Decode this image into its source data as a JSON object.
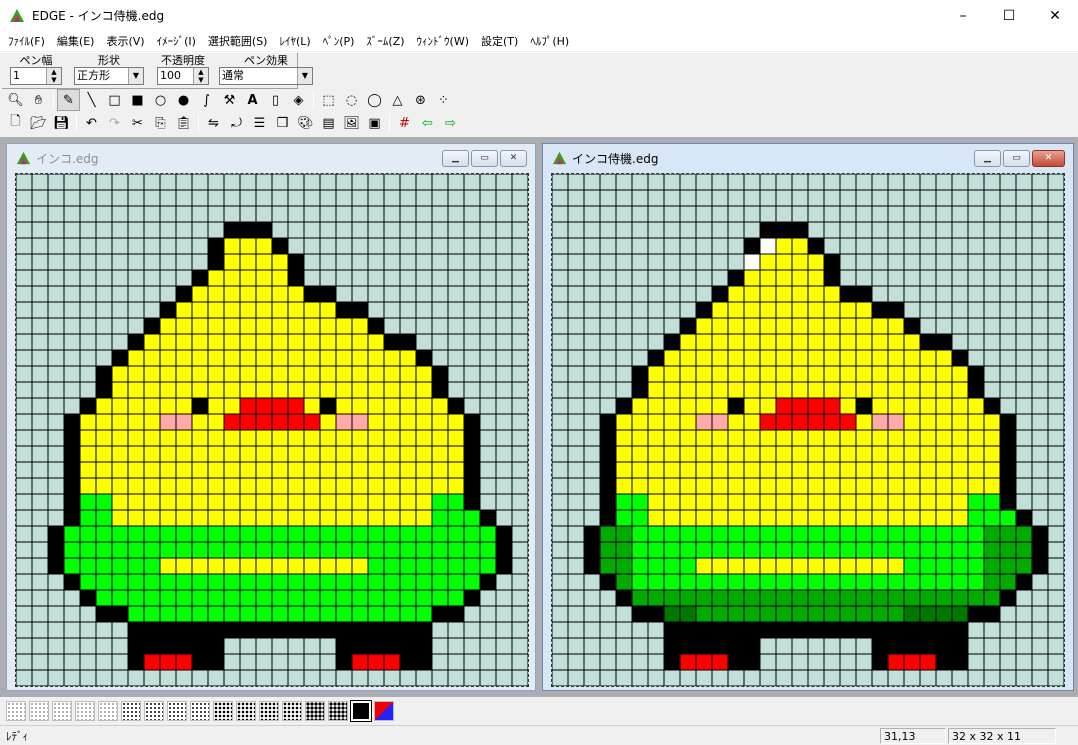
{
  "app": {
    "title": "EDGE - インコ侍機.edg",
    "caption": {
      "minimize": "–",
      "maximize": "☐",
      "close": "✕"
    }
  },
  "menu": [
    "ﾌｧｲﾙ(F)",
    "編集(E)",
    "表示(V)",
    "ｲﾒｰｼﾞ(I)",
    "選択範囲(S)",
    "ﾚｲﾔ(L)",
    "ﾍﾟﾝ(P)",
    "ｽﾞｰﾑ(Z)",
    "ｳｨﾝﾄﾞｳ(W)",
    "設定(T)",
    "ﾍﾙﾌﾟ(H)"
  ],
  "options": {
    "pen_width_label": "ペン幅",
    "pen_width_value": "1",
    "shape_label": "形状",
    "shape_value": "正方形",
    "opacity_label": "不透明度",
    "opacity_value": "100",
    "pen_effect_label": "ペン効果",
    "pen_effect_value": "通常"
  },
  "documents": [
    {
      "title": "インコ.edg",
      "active": false
    },
    {
      "title": "インコ侍機.edg",
      "active": true
    }
  ],
  "status": {
    "message": "ﾚﾃﾞｨ",
    "coords": "31,13",
    "size": "32 x 32 x 11"
  },
  "colors": {
    "canvas_bg": "#c2e0d9",
    "yellow": "#ffff00",
    "black": "#000000",
    "green": "#00ff00",
    "dark_green": "#00aa00",
    "darker_green": "#007700",
    "red": "#ff0000",
    "pink": "#ffaaaa",
    "white": "#ffffff"
  }
}
